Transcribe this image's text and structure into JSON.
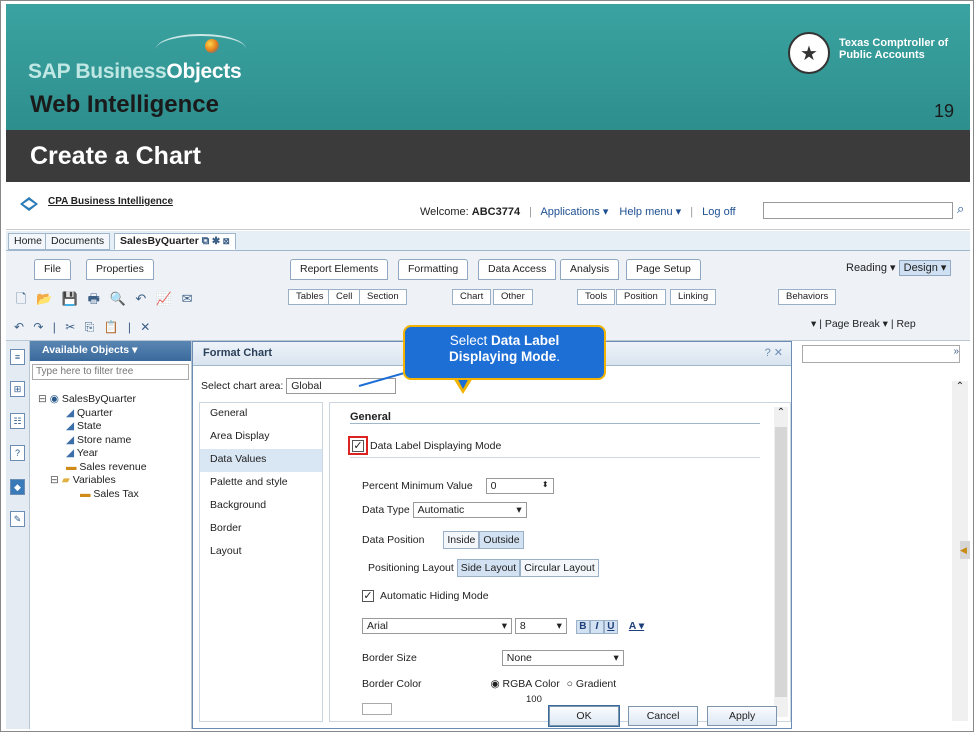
{
  "slide": {
    "brand_sap": "SAP Business",
    "brand_objects": "Objects",
    "product": "Web Intelligence",
    "agency_line1": "Texas Comptroller of",
    "agency_line2": "Public Accounts",
    "page_number": "19",
    "title": "Create a Chart"
  },
  "topbar": {
    "app_name": "CPA Business Intelligence",
    "welcome_label": "Welcome:",
    "user": "ABC3774",
    "applications": "Applications ▾",
    "help_menu": "Help menu ▾",
    "log_off": "Log off"
  },
  "doctabs": [
    "Home",
    "Documents",
    "SalesByQuarter"
  ],
  "toolbar": {
    "left_tabs": [
      "File",
      "Properties"
    ],
    "main_tabs": [
      "Report Elements",
      "Formatting",
      "Data Access",
      "Analysis",
      "Page Setup"
    ],
    "sub_tabs": [
      "Tables",
      "Cell",
      "Section",
      "Chart",
      "Other",
      "Tools",
      "Position",
      "Linking",
      "Behaviors"
    ],
    "reading": "Reading ▾",
    "design": "Design ▾",
    "page_break": "Page Break ▾",
    "rep": "Rep"
  },
  "available_objects": {
    "header": "Available Objects ▾",
    "filter_placeholder": "Type here to filter tree",
    "tree": [
      {
        "label": "SalesByQuarter",
        "level": 0,
        "icon": "universe-icon"
      },
      {
        "label": "Quarter",
        "level": 2,
        "icon": "dimension-icon"
      },
      {
        "label": "State",
        "level": 2,
        "icon": "dimension-icon"
      },
      {
        "label": "Store name",
        "level": 2,
        "icon": "dimension-icon"
      },
      {
        "label": "Year",
        "level": 2,
        "icon": "dimension-icon"
      },
      {
        "label": "Sales revenue",
        "level": 2,
        "icon": "measure-icon"
      },
      {
        "label": "Variables",
        "level": 1,
        "icon": "folder-icon"
      },
      {
        "label": "Sales Tax",
        "level": 3,
        "icon": "measure-icon"
      }
    ]
  },
  "dialog": {
    "title": "Format Chart",
    "area_label": "Select chart area:",
    "area_value": "Global",
    "nav": [
      "General",
      "Area Display",
      "Data Values",
      "Palette and style",
      "Background",
      "Border",
      "Layout"
    ],
    "selected_nav": "Data Values",
    "section_title": "General",
    "data_label_mode": "Data Label Displaying Mode",
    "percent_min_label": "Percent Minimum Value",
    "percent_min_value": "0",
    "data_type_label": "Data Type",
    "data_type_value": "Automatic",
    "data_position_label": "Data Position",
    "data_position_options": [
      "Inside",
      "Outside"
    ],
    "positioning_layout_label": "Positioning Layout",
    "positioning_layout_options": [
      "Side Layout",
      "Circular Layout"
    ],
    "auto_hiding": "Automatic Hiding Mode",
    "font_value": "Arial",
    "font_size": "8",
    "bold": "B",
    "italic": "I",
    "underline": "U",
    "font_color": "A",
    "border_size_label": "Border Size",
    "border_size_value": "None",
    "border_color_label": "Border Color",
    "rgba_label": "RGBA Color",
    "gradient_label": "Gradient",
    "opacity_value": "100",
    "ok": "OK",
    "cancel": "Cancel",
    "apply": "Apply"
  },
  "callout": {
    "prefix": "Select ",
    "bold1": "Data Label",
    "bold2": "Displaying Mode",
    "suffix": "."
  }
}
